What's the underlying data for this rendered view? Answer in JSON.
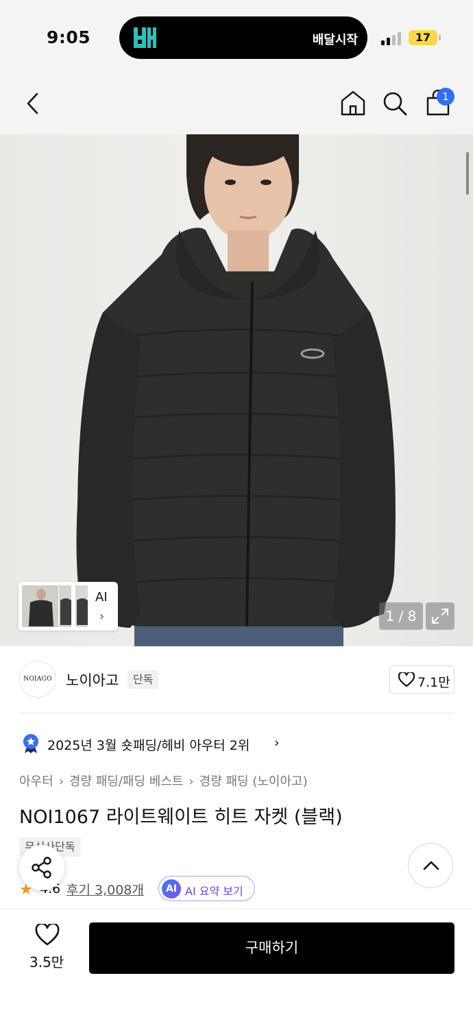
{
  "status_bar": {
    "time": "9:05",
    "island_logo": "배민",
    "island_text": "배달시작",
    "battery": "17"
  },
  "nav": {
    "cart_badge": "1",
    "icons": [
      "back-icon",
      "home-icon",
      "search-icon",
      "cart-icon"
    ]
  },
  "gallery": {
    "thumbnail_label": "AI",
    "counter": "1 / 8"
  },
  "brand": {
    "logo_text": "NOIAGO",
    "name": "노이아고",
    "tag": "단독",
    "like_count": "7.1만"
  },
  "ranking": {
    "text": "2025년 3월 숏패딩/헤비 아우터 2위",
    "chevron": "›"
  },
  "breadcrumb": {
    "items": [
      "아우터",
      "경량 패딩/패딩 베스트",
      "경량 패딩 (노이아고)"
    ],
    "separator": "›"
  },
  "product": {
    "title": "NOI1067 라이트웨이트 히트 자켓 (블랙)",
    "tag": "무신사단독",
    "rating": "4.6",
    "reviews": "후기 3,008개",
    "ai_badge": "AI",
    "ai_summary": "AI 요약 보기"
  },
  "bottom": {
    "wish_count": "3.5만",
    "buy_label": "구매하기"
  },
  "colors": {
    "accent_blue": "#2f6ff4",
    "battery_yellow": "#f6d84a",
    "star_orange": "#f29a1c",
    "ai_purple": "#6a45d8"
  }
}
